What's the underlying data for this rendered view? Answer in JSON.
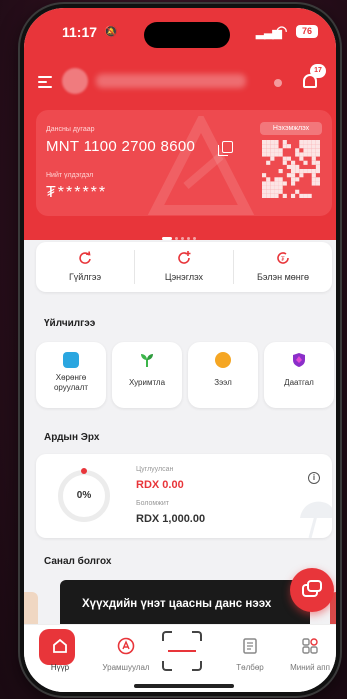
{
  "status_bar": {
    "time": "11:17",
    "battery": "76"
  },
  "header": {
    "notification_count": "17"
  },
  "account_card": {
    "account_label": "Дансны дугаар",
    "account_number": "MNT 1100 2700 8600",
    "balance_label": "Нийт үлдэгдэл",
    "balance_masked": "₮******",
    "qr_label": "Нэхэмжлэх"
  },
  "quick_actions": [
    {
      "label": "Гүйлгээ",
      "icon": "transfer-icon"
    },
    {
      "label": "Цэнэглэх",
      "icon": "topup-icon"
    },
    {
      "label": "Бэлэн мөнгө",
      "icon": "cash-icon"
    }
  ],
  "services": {
    "title": "Үйлчилгээ",
    "items": [
      {
        "label": "Хөрөнгө оруулалт",
        "icon": "investment-icon",
        "color": "#2aa6e0"
      },
      {
        "label": "Хуримтла",
        "icon": "savings-icon",
        "color": "#3cb54a"
      },
      {
        "label": "Зээл",
        "icon": "loan-icon",
        "color": "#f5a623"
      },
      {
        "label": "Даатгал",
        "icon": "insurance-icon",
        "color": "#8b2fc9"
      }
    ]
  },
  "rights": {
    "title": "Ардын Эрх",
    "percent": "0%",
    "percent_value": 0,
    "collected_label": "Цуглуулсан",
    "collected_value": "RDX 0.00",
    "possible_label": "Боломжит",
    "possible_value": "RDX 1,000.00"
  },
  "offers": {
    "title": "Санал болгох",
    "banner_text": "Хүүхдийн үнэт цаасны данс нээх"
  },
  "bottom_nav": [
    {
      "label": "Нүүр",
      "icon": "home-icon",
      "active": true
    },
    {
      "label": "Урамшуулал",
      "icon": "rewards-icon",
      "active": false
    },
    {
      "label": "",
      "icon": "scan-icon",
      "active": false
    },
    {
      "label": "Төлбөр",
      "icon": "payment-icon",
      "active": false
    },
    {
      "label": "Миний апп",
      "icon": "apps-icon",
      "active": false
    }
  ],
  "colors": {
    "brand_red": "#e8353a",
    "card_red": "#ee4a4f",
    "background": "#f2f2f4"
  }
}
